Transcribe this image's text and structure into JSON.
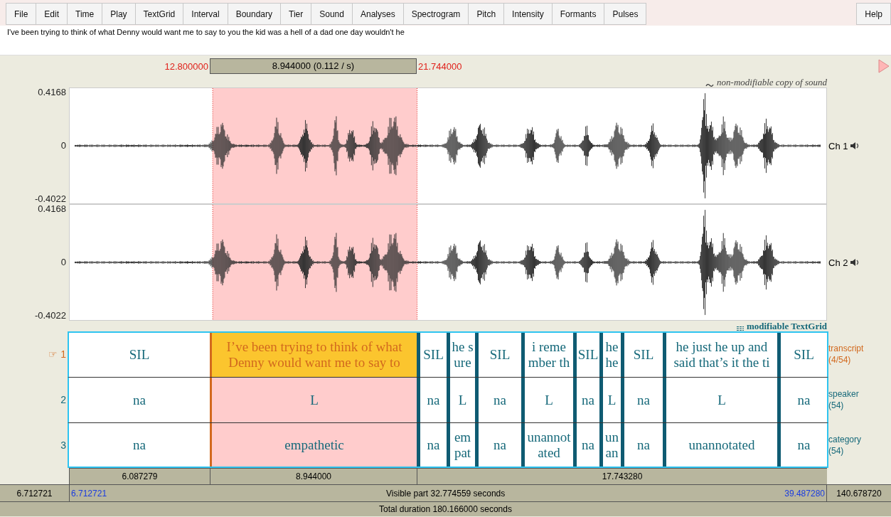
{
  "menu": [
    {
      "label": "File"
    },
    {
      "label": "Edit"
    },
    {
      "label": "Time"
    },
    {
      "label": "Play"
    },
    {
      "label": "TextGrid"
    },
    {
      "label": "Interval"
    },
    {
      "label": "Boundary"
    },
    {
      "label": "Tier"
    },
    {
      "label": "Sound"
    },
    {
      "label": "Analyses"
    },
    {
      "label": "Spectrogram"
    },
    {
      "label": "Pitch"
    },
    {
      "label": "Intensity"
    },
    {
      "label": "Formants"
    },
    {
      "label": "Pulses"
    }
  ],
  "help": "Help",
  "text_field": {
    "value": "I've been trying to think of what Denny would want me to say to you the kid was a hell of a dad one day wouldn't he"
  },
  "selection": {
    "start": "12.800000",
    "length": "8.944000 (0.112 / s)",
    "end": "21.744000"
  },
  "sound_label": "non-modifiable copy of sound",
  "textgrid_label": "modifiable TextGrid",
  "channels": [
    {
      "name": "Ch 1",
      "max": "0.4168",
      "zero": "0",
      "min": "-0.4022"
    },
    {
      "name": "Ch 2",
      "max": "0.4168",
      "zero": "0",
      "min": "-0.4022"
    }
  ],
  "tiers": [
    {
      "number": "1",
      "pointer": "☞",
      "name": "transcript",
      "count": "(4/54)",
      "selected": true,
      "intervals": [
        {
          "text": "SIL",
          "selected": false
        },
        {
          "text": "I’ve been trying to think of what Denny would want me to say to",
          "selected": true
        },
        {
          "text": "SIL",
          "selected": false
        },
        {
          "text": "he s\nure",
          "selected": false
        },
        {
          "text": "SIL",
          "selected": false
        },
        {
          "text": "i reme\nmber th",
          "selected": false
        },
        {
          "text": "SIL",
          "selected": false
        },
        {
          "text": "he\nhe",
          "selected": false
        },
        {
          "text": "SIL",
          "selected": false
        },
        {
          "text": "he just he up and said that’s it the ti",
          "selected": false
        },
        {
          "text": "SIL",
          "selected": false
        }
      ]
    },
    {
      "number": "2",
      "name": "speaker",
      "count": "(54)",
      "selected": false,
      "intervals": [
        {
          "text": "na",
          "selected": false
        },
        {
          "text": "L",
          "selected": true
        },
        {
          "text": "na",
          "selected": false
        },
        {
          "text": "L",
          "selected": false
        },
        {
          "text": "na",
          "selected": false
        },
        {
          "text": "L",
          "selected": false
        },
        {
          "text": "na",
          "selected": false
        },
        {
          "text": "L",
          "selected": false
        },
        {
          "text": "na",
          "selected": false
        },
        {
          "text": "L",
          "selected": false
        },
        {
          "text": "na",
          "selected": false
        }
      ]
    },
    {
      "number": "3",
      "name": "category",
      "count": "(54)",
      "selected": false,
      "intervals": [
        {
          "text": "na",
          "selected": false
        },
        {
          "text": "empathetic",
          "selected": true
        },
        {
          "text": "na",
          "selected": false
        },
        {
          "text": "em\npat",
          "selected": false
        },
        {
          "text": "na",
          "selected": false
        },
        {
          "text": "unannot\nated",
          "selected": false
        },
        {
          "text": "na",
          "selected": false
        },
        {
          "text": "un\nan",
          "selected": false
        },
        {
          "text": "na",
          "selected": false
        },
        {
          "text": "unannotated",
          "selected": false
        },
        {
          "text": "na",
          "selected": false
        }
      ]
    }
  ],
  "durations": [
    "6.087279",
    "8.944000",
    "17.743280"
  ],
  "visible_part": {
    "left_outside": "6.712721",
    "start": "6.712721",
    "label": "Visible part 32.774559 seconds",
    "end": "39.487280",
    "right_outside": "140.678720"
  },
  "total": "Total duration 180.166000 seconds"
}
